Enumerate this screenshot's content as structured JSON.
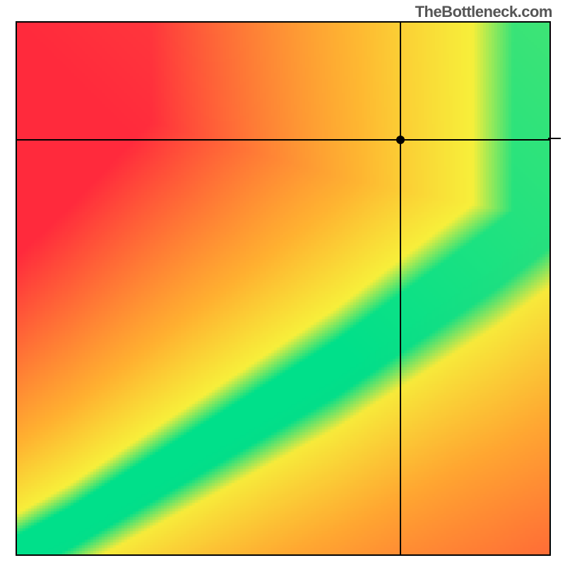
{
  "attribution": "TheBottleneck.com",
  "chart_data": {
    "type": "heatmap",
    "title": "",
    "xlabel": "",
    "ylabel": "",
    "xlim": [
      0,
      1
    ],
    "ylim": [
      0,
      1
    ],
    "grid": false,
    "legend": false,
    "marker": {
      "x": 0.72,
      "y": 0.78
    },
    "crosshair": {
      "x": 0.72,
      "y": 0.78
    },
    "optimal_curve_description": "Green band along a curved diagonal from bottom-left to right side, representing balanced component ratio; red regions far from diagonal indicate bottleneck; yellow is transitional.",
    "optimal_curve_points": [
      {
        "x": 0.0,
        "y": 0.0
      },
      {
        "x": 0.1,
        "y": 0.05
      },
      {
        "x": 0.2,
        "y": 0.11
      },
      {
        "x": 0.3,
        "y": 0.17
      },
      {
        "x": 0.4,
        "y": 0.23
      },
      {
        "x": 0.5,
        "y": 0.29
      },
      {
        "x": 0.6,
        "y": 0.35
      },
      {
        "x": 0.7,
        "y": 0.42
      },
      {
        "x": 0.8,
        "y": 0.49
      },
      {
        "x": 0.9,
        "y": 0.56
      },
      {
        "x": 1.0,
        "y": 0.64
      }
    ],
    "band_half_width": 0.035,
    "color_stops": {
      "optimal": "#00e08a",
      "near": "#f7ef3a",
      "mid": "#ffb030",
      "far": "#ff2a3c"
    }
  }
}
